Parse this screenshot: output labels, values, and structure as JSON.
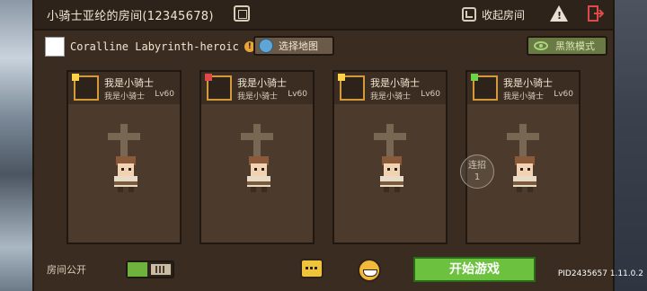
{
  "room": {
    "title": "小骑士亚纶的房间(12345678)",
    "collapse_label": "收起房间"
  },
  "dungeon": {
    "name": "Coralline Labyrinth-heroic",
    "select_map_label": "选择地图",
    "dark_mode_label": "黑煞模式"
  },
  "players": [
    {
      "name": "我是小骑士",
      "sub": "我是小骑士",
      "level": "Lv60",
      "badge_color": "#ffd24a"
    },
    {
      "name": "我是小骑士",
      "sub": "我是小骑士",
      "level": "Lv60",
      "badge_color": "#e0494a"
    },
    {
      "name": "我是小骑士",
      "sub": "我是小骑士",
      "level": "Lv60",
      "badge_color": "#ffd24a"
    },
    {
      "name": "我是小骑士",
      "sub": "我是小骑士",
      "level": "Lv60",
      "badge_color": "#6fd34a"
    }
  ],
  "combo": {
    "line1": "连招",
    "line2": "1"
  },
  "bottom": {
    "public_label": "房间公开",
    "start_label": "开始游戏",
    "version": "PID2435657 1.11.0.2"
  },
  "colors": {
    "accent_green": "#6cc23e",
    "avatar_border": "#d49a3a",
    "panel": "#3a2c21"
  }
}
